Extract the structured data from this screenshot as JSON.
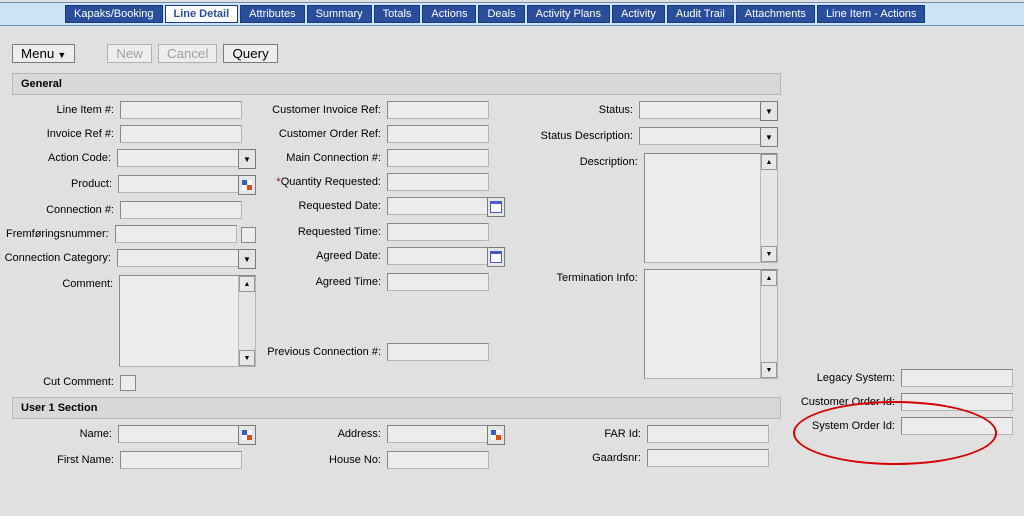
{
  "tabs": [
    {
      "label": "Kapaks/Booking"
    },
    {
      "label": "Line Detail",
      "active": true
    },
    {
      "label": "Attributes"
    },
    {
      "label": "Summary"
    },
    {
      "label": "Totals"
    },
    {
      "label": "Actions"
    },
    {
      "label": "Deals"
    },
    {
      "label": "Activity Plans"
    },
    {
      "label": "Activity"
    },
    {
      "label": "Audit Trail"
    },
    {
      "label": "Attachments"
    },
    {
      "label": "Line Item - Actions"
    }
  ],
  "toolbar": {
    "menu": "Menu",
    "new": "New",
    "cancel": "Cancel",
    "query": "Query"
  },
  "sections": {
    "general": {
      "title": "General",
      "col1": {
        "line_item_no": "Line Item #:",
        "invoice_ref_no": "Invoice Ref #:",
        "action_code": "Action Code:",
        "product": "Product:",
        "connection_no": "Connection #:",
        "fremforingsnummer": "Fremføringsnummer:",
        "connection_category": "Connection Category:",
        "comment": "Comment:",
        "cut_comment": "Cut Comment:"
      },
      "col2": {
        "customer_invoice_ref": "Customer Invoice Ref:",
        "customer_order_ref": "Customer Order Ref:",
        "main_connection_no": "Main Connection #:",
        "quantity_requested": "Quantity Requested:",
        "requested_date": "Requested Date:",
        "requested_time": "Requested Time:",
        "agreed_date": "Agreed Date:",
        "agreed_time": "Agreed Time:",
        "previous_connection_no": "Previous Connection #:"
      },
      "col3": {
        "status": "Status:",
        "status_description": "Status Description:",
        "description": "Description:",
        "termination_info": "Termination Info:"
      }
    },
    "user1": {
      "title": "User 1 Section",
      "col1": {
        "name": "Name:",
        "first_name": "First Name:"
      },
      "col2": {
        "address": "Address:",
        "house_no": "House No:"
      },
      "col3": {
        "far_id": "FAR Id:",
        "gaardsnr": "Gaardsnr:"
      }
    }
  },
  "side": {
    "legacy_system": "Legacy System:",
    "customer_order_id": "Customer Order Id:",
    "system_order_id": "System Order Id:"
  },
  "values": {
    "line_item_no": "",
    "invoice_ref_no": "",
    "action_code": "",
    "product": "",
    "connection_no": "",
    "fremforingsnummer": "",
    "connection_category": "",
    "comment": "",
    "cut_comment": false,
    "customer_invoice_ref": "",
    "customer_order_ref": "",
    "main_connection_no": "",
    "quantity_requested": "",
    "requested_date": "",
    "requested_time": "",
    "agreed_date": "",
    "agreed_time": "",
    "previous_connection_no": "",
    "status": "",
    "status_description": "",
    "description": "",
    "termination_info": "",
    "name": "",
    "first_name": "",
    "address": "",
    "house_no": "",
    "far_id": "",
    "gaardsnr": "",
    "legacy_system": "",
    "customer_order_id": "",
    "system_order_id": ""
  }
}
